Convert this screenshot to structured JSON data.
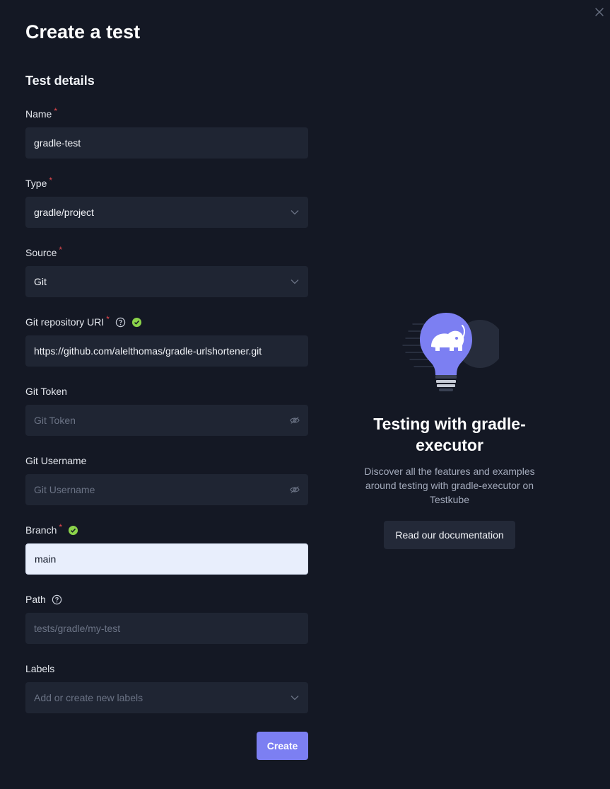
{
  "title": "Create a test",
  "section_title": "Test details",
  "required_mark": "*",
  "fields": {
    "name": {
      "label": "Name",
      "value": "gradle-test"
    },
    "type": {
      "label": "Type",
      "value": "gradle/project"
    },
    "source": {
      "label": "Source",
      "value": "Git"
    },
    "git_uri": {
      "label": "Git repository URI",
      "value": "https://github.com/alelthomas/gradle-urlshortener.git"
    },
    "git_token": {
      "label": "Git Token",
      "placeholder": "Git Token"
    },
    "git_username": {
      "label": "Git Username",
      "placeholder": "Git Username"
    },
    "branch": {
      "label": "Branch",
      "value": "main"
    },
    "path": {
      "label": "Path",
      "placeholder": "tests/gradle/my-test"
    },
    "labels": {
      "label": "Labels",
      "placeholder": "Add or create new labels"
    }
  },
  "create_label": "Create",
  "promo": {
    "title": "Testing with gradle-executor",
    "text": "Discover all the features and examples around testing with gradle-executor on Testkube",
    "button_label": "Read our documentation"
  },
  "colors": {
    "background": "#141824",
    "input_bg": "#1f2533",
    "accent": "#7c7ff2",
    "required": "#e5484d",
    "success": "#8bd34a"
  },
  "icons": [
    "close-icon",
    "help-icon",
    "check-circle-icon",
    "chevron-down-icon",
    "eye-off-icon",
    "lightbulb-illustration"
  ]
}
